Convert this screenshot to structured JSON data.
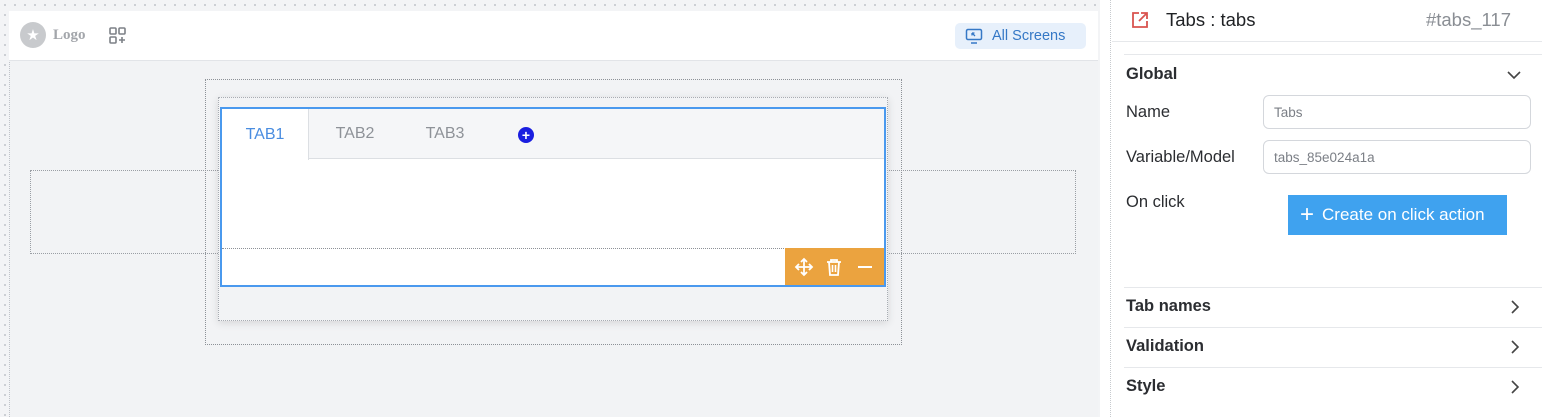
{
  "canvas": {
    "logo_text": "Logo",
    "all_screens_label": "All Screens",
    "tabs": [
      {
        "label": "TAB1",
        "active": true
      },
      {
        "label": "TAB2",
        "active": false
      },
      {
        "label": "TAB3",
        "active": false
      }
    ],
    "add_tab_symbol": "+",
    "toolbar_icons": [
      "move-icon",
      "trash-icon",
      "minus-icon"
    ],
    "accent_color": "#4a99ee",
    "toolbar_color": "#eba33f"
  },
  "panel": {
    "title": "Tabs : tabs",
    "id": "#tabs_117",
    "global_section": "Global",
    "name_label": "Name",
    "name_placeholder": "Tabs",
    "variable_label": "Variable/Model",
    "variable_placeholder": "tabs_85e024a1a",
    "onclick_label": "On click",
    "create_action_label": "Create on click action",
    "sections": [
      "Tab names",
      "Validation",
      "Style"
    ],
    "button_color": "#3fa2ef"
  }
}
